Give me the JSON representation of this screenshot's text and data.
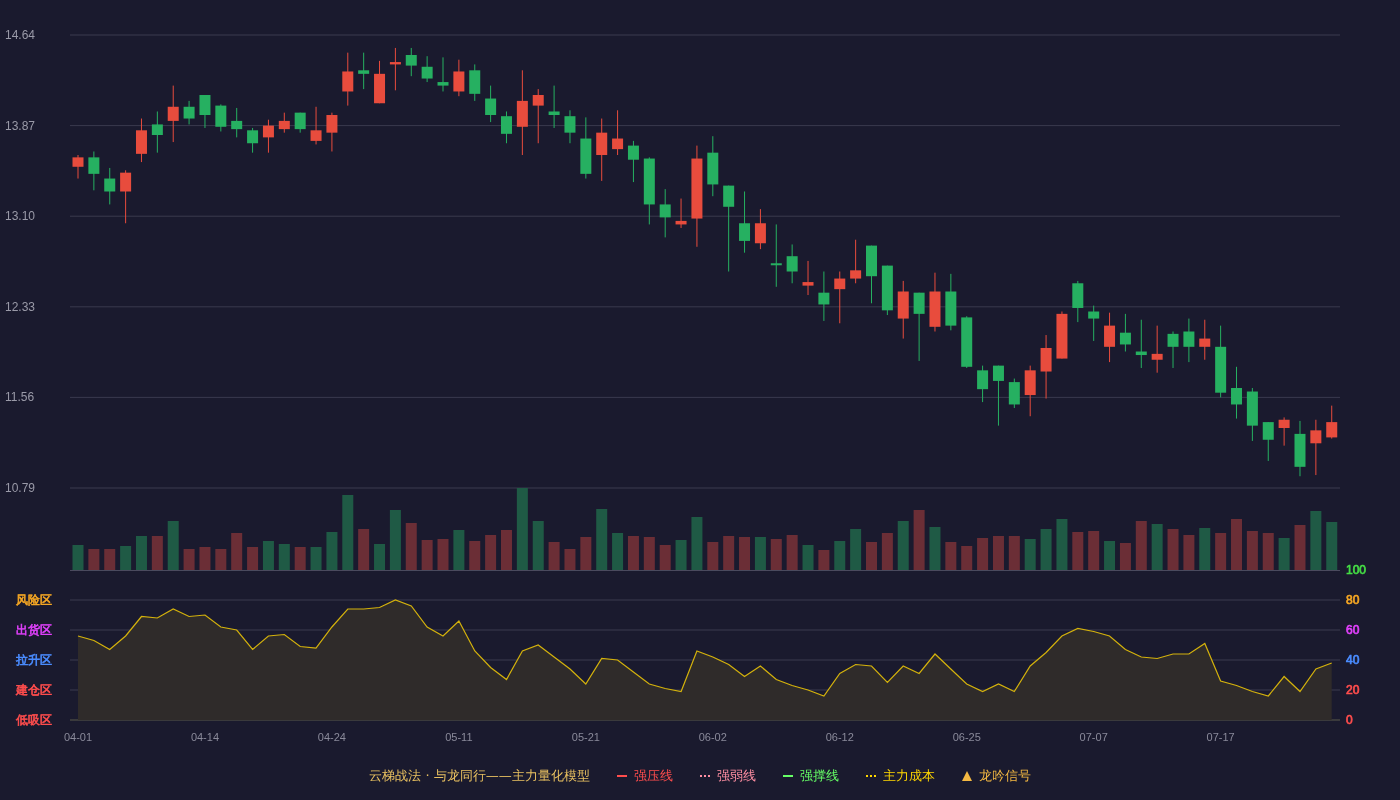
{
  "price_chart": {
    "chart_data": {
      "type": "candlestick",
      "grid": true,
      "ylim": [
        10.79,
        14.64
      ],
      "yticks": [
        {
          "value": 14.64,
          "label": "14.64"
        },
        {
          "value": 13.87,
          "label": "13.87"
        },
        {
          "value": 13.1,
          "label": "13.10"
        },
        {
          "value": 12.33,
          "label": "12.33"
        },
        {
          "value": 11.56,
          "label": "11.56"
        },
        {
          "value": 10.79,
          "label": "10.79"
        }
      ],
      "ohlc": [
        [
          13.52,
          13.62,
          13.42,
          13.6
        ],
        [
          13.6,
          13.65,
          13.32,
          13.46
        ],
        [
          13.42,
          13.51,
          13.2,
          13.31
        ],
        [
          13.31,
          13.49,
          13.04,
          13.47
        ],
        [
          13.63,
          13.93,
          13.56,
          13.83
        ],
        [
          13.88,
          13.99,
          13.64,
          13.79
        ],
        [
          13.91,
          14.21,
          13.73,
          14.03
        ],
        [
          14.03,
          14.08,
          13.88,
          13.93
        ],
        [
          14.13,
          14.13,
          13.85,
          13.96
        ],
        [
          14.04,
          14.05,
          13.82,
          13.86
        ],
        [
          13.91,
          14.02,
          13.77,
          13.84
        ],
        [
          13.83,
          13.85,
          13.64,
          13.72
        ],
        [
          13.77,
          13.92,
          13.64,
          13.87
        ],
        [
          13.84,
          13.98,
          13.81,
          13.91
        ],
        [
          13.98,
          13.98,
          13.81,
          13.84
        ],
        [
          13.74,
          14.03,
          13.71,
          13.83
        ],
        [
          13.81,
          13.98,
          13.65,
          13.96
        ],
        [
          14.16,
          14.49,
          14.04,
          14.33
        ],
        [
          14.34,
          14.49,
          14.18,
          14.31
        ],
        [
          14.06,
          14.42,
          14.06,
          14.31
        ],
        [
          14.39,
          14.53,
          14.17,
          14.41
        ],
        [
          14.47,
          14.53,
          14.29,
          14.38
        ],
        [
          14.37,
          14.46,
          14.24,
          14.27
        ],
        [
          14.24,
          14.45,
          14.16,
          14.21
        ],
        [
          14.16,
          14.43,
          14.12,
          14.33
        ],
        [
          14.34,
          14.39,
          14.08,
          14.14
        ],
        [
          14.1,
          14.21,
          13.9,
          13.96
        ],
        [
          13.95,
          13.99,
          13.72,
          13.8
        ],
        [
          13.86,
          14.34,
          13.62,
          14.08
        ],
        [
          14.04,
          14.18,
          13.72,
          14.13
        ],
        [
          13.99,
          14.21,
          13.85,
          13.96
        ],
        [
          13.95,
          14.0,
          13.72,
          13.81
        ],
        [
          13.76,
          13.94,
          13.42,
          13.46
        ],
        [
          13.62,
          13.93,
          13.4,
          13.81
        ],
        [
          13.67,
          14.0,
          13.62,
          13.76
        ],
        [
          13.7,
          13.74,
          13.39,
          13.58
        ],
        [
          13.59,
          13.6,
          13.03,
          13.2
        ],
        [
          13.2,
          13.33,
          12.92,
          13.09
        ],
        [
          13.03,
          13.25,
          13.0,
          13.06
        ],
        [
          13.08,
          13.7,
          12.84,
          13.59
        ],
        [
          13.64,
          13.78,
          13.27,
          13.37
        ],
        [
          13.36,
          13.36,
          12.63,
          13.18
        ],
        [
          13.04,
          13.31,
          12.79,
          12.89
        ],
        [
          12.87,
          13.16,
          12.82,
          13.04
        ],
        [
          12.7,
          13.03,
          12.5,
          12.69
        ],
        [
          12.76,
          12.86,
          12.53,
          12.63
        ],
        [
          12.51,
          12.72,
          12.43,
          12.54
        ],
        [
          12.45,
          12.63,
          12.21,
          12.35
        ],
        [
          12.48,
          12.63,
          12.19,
          12.57
        ],
        [
          12.57,
          12.9,
          12.53,
          12.64
        ],
        [
          12.85,
          12.85,
          12.36,
          12.59
        ],
        [
          12.68,
          12.68,
          12.26,
          12.3
        ],
        [
          12.23,
          12.55,
          12.06,
          12.46
        ],
        [
          12.45,
          12.45,
          11.87,
          12.27
        ],
        [
          12.16,
          12.62,
          12.12,
          12.46
        ],
        [
          12.46,
          12.61,
          12.13,
          12.17
        ],
        [
          12.24,
          12.25,
          11.81,
          11.82
        ],
        [
          11.79,
          11.83,
          11.52,
          11.63
        ],
        [
          11.83,
          11.83,
          11.32,
          11.7
        ],
        [
          11.69,
          11.72,
          11.47,
          11.5
        ],
        [
          11.58,
          11.83,
          11.4,
          11.79
        ],
        [
          11.78,
          12.09,
          11.55,
          11.98
        ],
        [
          11.89,
          12.29,
          11.89,
          12.27
        ],
        [
          12.53,
          12.55,
          12.2,
          12.32
        ],
        [
          12.29,
          12.34,
          12.04,
          12.23
        ],
        [
          11.99,
          12.28,
          11.86,
          12.17
        ],
        [
          12.11,
          12.27,
          11.95,
          12.01
        ],
        [
          11.95,
          12.22,
          11.81,
          11.92
        ],
        [
          11.88,
          12.17,
          11.77,
          11.93
        ],
        [
          12.1,
          12.12,
          11.81,
          11.99
        ],
        [
          12.12,
          12.23,
          11.86,
          11.99
        ],
        [
          11.99,
          12.22,
          11.88,
          12.06
        ],
        [
          11.99,
          12.17,
          11.56,
          11.6
        ],
        [
          11.64,
          11.82,
          11.38,
          11.5
        ],
        [
          11.61,
          11.64,
          11.19,
          11.32
        ],
        [
          11.35,
          11.35,
          11.02,
          11.2
        ],
        [
          11.3,
          11.39,
          11.15,
          11.37
        ],
        [
          11.25,
          11.36,
          10.89,
          10.97
        ],
        [
          11.17,
          11.37,
          10.9,
          11.28
        ],
        [
          11.22,
          11.49,
          11.21,
          11.35
        ]
      ]
    }
  },
  "indicator": {
    "zones": [
      {
        "label": "风险区",
        "color": "#f5a623"
      },
      {
        "label": "出货区",
        "color": "#e040fb"
      },
      {
        "label": "拉升区",
        "color": "#4a8cff"
      },
      {
        "label": "建仓区",
        "color": "#ff4d4d"
      },
      {
        "label": "低吸区",
        "color": "#ff4d4d"
      }
    ],
    "tick_label_colors": [
      {
        "color": "#ff4d4d"
      },
      {
        "color": "#ff4d4d"
      },
      {
        "color": "#4a8cff"
      },
      {
        "color": "#e040fb"
      },
      {
        "color": "#f5a623"
      },
      {
        "color": "#44dd44"
      }
    ],
    "chart_data": {
      "type": "area",
      "grid": true,
      "ylim": [
        0,
        100
      ],
      "categories": [
        "04-01",
        null,
        null,
        null,
        null,
        null,
        null,
        null,
        "04-14",
        null,
        null,
        null,
        null,
        null,
        null,
        null,
        "04-24",
        null,
        null,
        null,
        null,
        null,
        null,
        null,
        "05-11",
        null,
        null,
        null,
        null,
        null,
        null,
        null,
        "05-21",
        null,
        null,
        null,
        null,
        null,
        null,
        null,
        "06-02",
        null,
        null,
        null,
        null,
        null,
        null,
        null,
        "06-12",
        null,
        null,
        null,
        null,
        null,
        null,
        null,
        "06-25",
        null,
        null,
        null,
        null,
        null,
        null,
        null,
        "07-07",
        null,
        null,
        null,
        null,
        null,
        null,
        null,
        "07-17",
        null,
        null,
        null,
        null,
        null,
        null,
        null
      ],
      "yticks": [
        {
          "value": 0,
          "label": "0"
        },
        {
          "value": 20,
          "label": "20"
        },
        {
          "value": 40,
          "label": "40"
        },
        {
          "value": 60,
          "label": "60"
        },
        {
          "value": 80,
          "label": "80"
        },
        {
          "value": 100,
          "label": "100"
        }
      ],
      "series": [
        {
          "color": "#d4b20c",
          "values": [
            56,
            53,
            47,
            56,
            69,
            68,
            74,
            69,
            70,
            62,
            60,
            47,
            56,
            57,
            49,
            48,
            62,
            74,
            74,
            75,
            80,
            76,
            62,
            56,
            66,
            46,
            35,
            27,
            46,
            50,
            42,
            34,
            24,
            41,
            40,
            32,
            24,
            21,
            19,
            46,
            42,
            37,
            29,
            36,
            27,
            23,
            20,
            16,
            31,
            37,
            36,
            25,
            36,
            31,
            44,
            34,
            24,
            19,
            24,
            19,
            36,
            45,
            56,
            61,
            59,
            56,
            47,
            42,
            41,
            44,
            44,
            51,
            26,
            23,
            19,
            16,
            29,
            19,
            34,
            38
          ]
        }
      ]
    }
  },
  "legend": {
    "title": "云梯战法 · 与龙同行——主力量化模型",
    "items": [
      {
        "label": "强压线",
        "kind": "solid",
        "color": "#ff4d4d"
      },
      {
        "label": "强弱线",
        "kind": "dashed",
        "color": "#ff8fa3"
      },
      {
        "label": "强撑线",
        "kind": "solid",
        "color": "#66ff66"
      },
      {
        "label": "主力成本",
        "kind": "dashed",
        "color": "#ffd700"
      },
      {
        "label": "龙吟信号",
        "kind": "triangle",
        "color": "#f5b942"
      }
    ]
  }
}
